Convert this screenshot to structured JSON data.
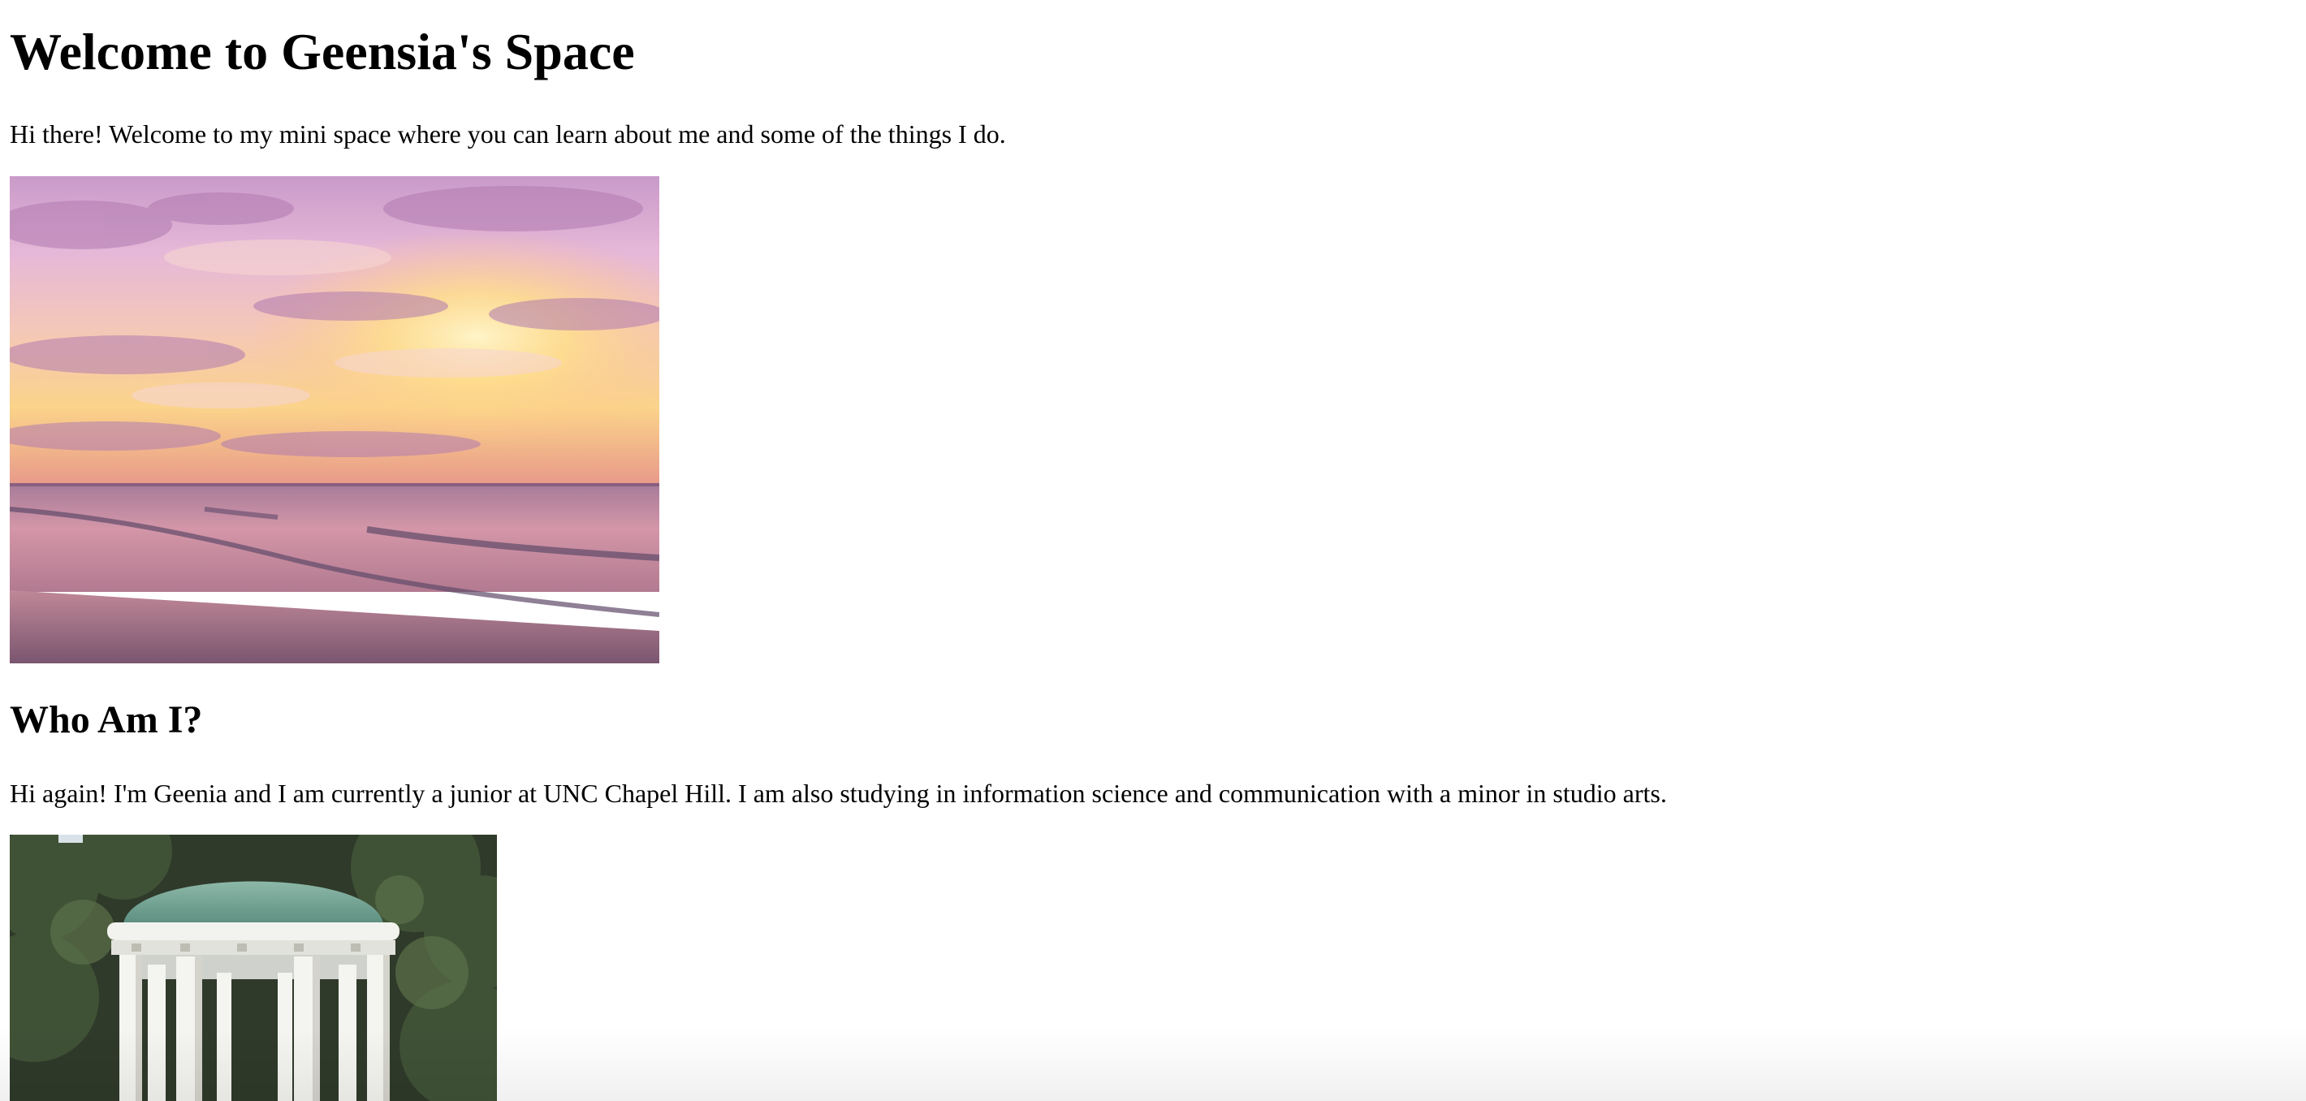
{
  "page": {
    "heading": "Welcome to Geensia's Space",
    "intro": "Hi there! Welcome to my mini space where you can learn about me and some of the things I do.",
    "section_heading": "Who Am I?",
    "section_text": "Hi again! I'm Geenia and I am currently a junior at UNC Chapel Hill. I am also studying in information science and communication with a minor in studio arts."
  },
  "images": {
    "sunset": "sunset-beach-image",
    "wellhead": "old-well-rotunda-image"
  }
}
